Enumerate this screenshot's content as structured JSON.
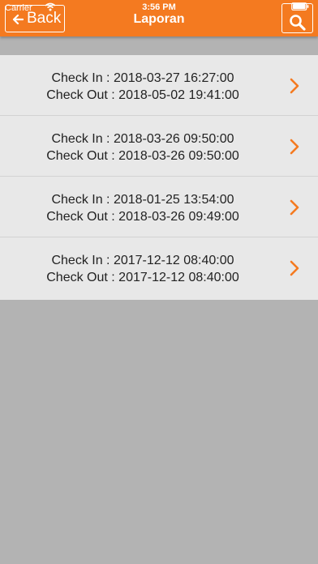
{
  "status_bar": {
    "carrier": "Carrier",
    "time": "3:56 PM",
    "wifi_icon": "wifi-icon",
    "battery_icon": "battery-icon"
  },
  "navbar": {
    "back_label": "Back",
    "back_icon": "arrow-left-icon",
    "title": "Laporan",
    "search_icon": "search-icon",
    "background_color": "#f47a20"
  },
  "reports": [
    {
      "check_in": "Check In : 2018-03-27 16:27:00",
      "check_out": "Check Out : 2018-05-02 19:41:00"
    },
    {
      "check_in": "Check In : 2018-03-26 09:50:00",
      "check_out": "Check Out : 2018-03-26 09:50:00"
    },
    {
      "check_in": "Check In : 2018-01-25 13:54:00",
      "check_out": "Check Out : 2018-03-26 09:49:00"
    },
    {
      "check_in": "Check In : 2017-12-12 08:40:00",
      "check_out": "Check Out : 2017-12-12 08:40:00"
    }
  ],
  "row_chevron_icon": "chevron-right-icon",
  "accent_color": "#f47a20"
}
